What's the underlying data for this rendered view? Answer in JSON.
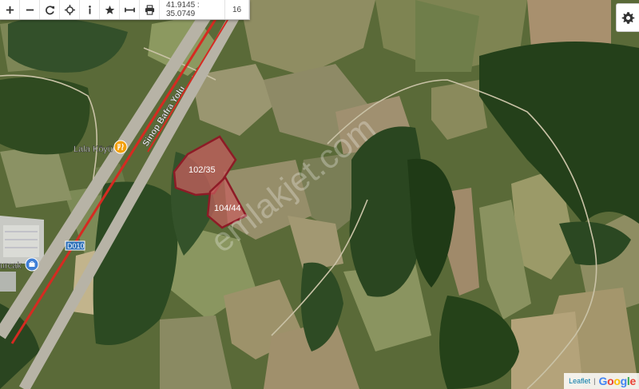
{
  "toolbar": {
    "buttons": [
      {
        "name": "zoom-in-button",
        "icon": "plus-icon"
      },
      {
        "name": "zoom-out-button",
        "icon": "minus-icon"
      },
      {
        "name": "refresh-button",
        "icon": "refresh-icon"
      },
      {
        "name": "locate-button",
        "icon": "crosshair-icon"
      },
      {
        "name": "info-button",
        "icon": "info-icon"
      },
      {
        "name": "favorite-button",
        "icon": "star-icon"
      },
      {
        "name": "measure-button",
        "icon": "ruler-icon"
      },
      {
        "name": "print-button",
        "icon": "printer-icon"
      }
    ],
    "coordinates": "41.9145 : 35.0749",
    "zoom": "16"
  },
  "map": {
    "labels": {
      "road": "Sinop Bafra Yolu",
      "village": "Lala Köyü",
      "town": "urcak",
      "route": "D010",
      "watermark": "emlakjet.com"
    },
    "parcels": [
      {
        "label": "102/35"
      },
      {
        "label": "104/44"
      }
    ]
  },
  "attribution": {
    "leaflet": "Leaflet",
    "separator": "|",
    "google": [
      "G",
      "o",
      "o",
      "g",
      "l",
      "e"
    ]
  },
  "colors": {
    "road": "#d62a21",
    "parcel_outline": "#8e1b26",
    "parcel_fill": "#c75f5f",
    "forest": "#2d4a1e",
    "field": "#8c8a60"
  }
}
